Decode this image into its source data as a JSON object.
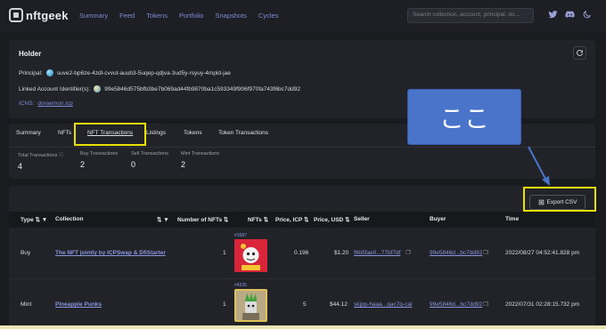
{
  "app": {
    "logo_text": "nftgeek",
    "nav": [
      "Summary",
      "Feed",
      "Tokens",
      "Portfolio",
      "Snapshots",
      "Cycles"
    ],
    "search_placeholder": "Search collection, account, principal, do..."
  },
  "holder": {
    "title": "Holder",
    "principal_label": "Principal:",
    "principal_value": "suve2-bp6ze-4zdl-cvvut-auub3-5uqep-qdjva-3ud5y-rsyuy-4mpld-jae",
    "linked_label": "Linked Account Identifier(s):",
    "linked_value": "99e5846d575bfb3be7b069ad44fb9870ba1c593349f906f970fa743f6bc7dd92",
    "icns_label": "ICNS:",
    "icns_value": "doraemon.icp"
  },
  "tabs": [
    "Summary",
    "NFTs",
    "NFT Transactions",
    "Listings",
    "Tokens",
    "Token Transactions"
  ],
  "stats": [
    {
      "label": "Total Transactions",
      "value": "4"
    },
    {
      "label": "Buy Transactions",
      "value": "2"
    },
    {
      "label": "Sell Transactions",
      "value": "0"
    },
    {
      "label": "Mint Transactions",
      "value": "2"
    }
  ],
  "export_label": "Export CSV",
  "table": {
    "headers": [
      "Type",
      "Collection",
      "Number of NFTs",
      "NFTs",
      "Price, ICP",
      "Price, USD",
      "Seller",
      "Buyer",
      "Time"
    ],
    "rows": [
      {
        "type": "Buy",
        "collection": "The NFT jointly by ICPSwap & DfiStarter",
        "number": "1",
        "nft_id": "#1687",
        "price_icp": "0.196",
        "price_usd": "$1.20",
        "seller": "f6b5fae0...77bf7df",
        "buyer": "99e5846d...bc7dd92",
        "time": "2022/08/27 04:52:41.828 pm"
      },
      {
        "type": "Mint",
        "collection": "Pineapple Punks",
        "number": "1",
        "nft_id": "#4335",
        "price_icp": "5",
        "price_usd": "$44.12",
        "seller": "skjpp-haaa...qac7q-cai",
        "buyer": "99e5846d...bc7dd92",
        "time": "2022/07/31 02:28:15.732 pm"
      }
    ]
  },
  "annotation": {
    "callout_text": "ここ"
  },
  "colors": {
    "accent": "#7e8bd8",
    "highlight": "#e8e100",
    "callout_bg": "#4a74c9",
    "background": "#1a1b1f"
  }
}
